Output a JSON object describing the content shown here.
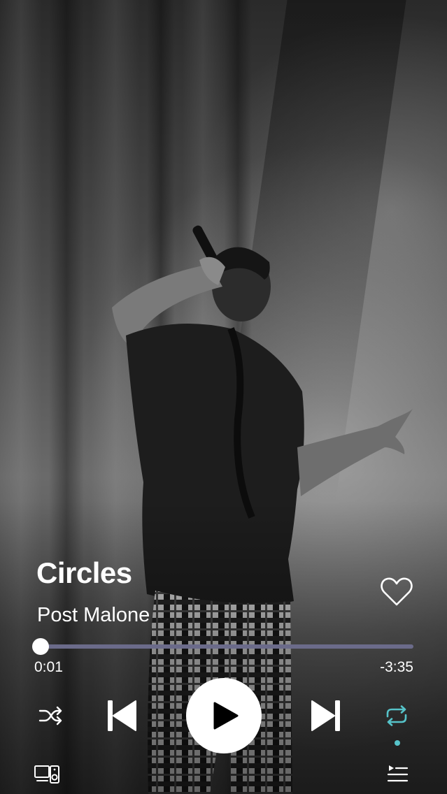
{
  "track": {
    "title": "Circles",
    "artist": "Post Malone",
    "liked": false
  },
  "playback": {
    "elapsed": "0:01",
    "remaining": "-3:35",
    "progress": 0.005,
    "is_playing": false,
    "shuffle": false,
    "repeat": true
  },
  "colors": {
    "accent": "#56c3c9",
    "track_bg": "#6b6b8a",
    "foreground": "#ffffff"
  },
  "icons": {
    "like": "heart-outline-icon",
    "shuffle": "shuffle-icon",
    "previous": "skip-previous-icon",
    "play": "play-icon",
    "next": "skip-next-icon",
    "repeat": "repeat-icon",
    "devices": "devices-icon",
    "queue": "queue-icon"
  }
}
